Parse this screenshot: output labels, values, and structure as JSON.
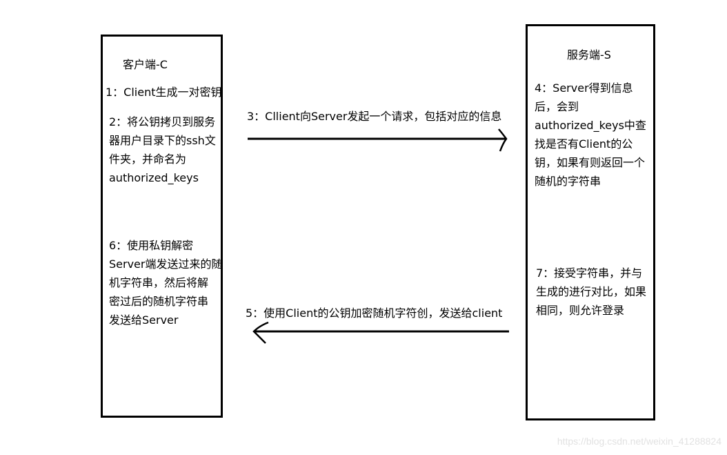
{
  "client": {
    "title": "客户端-C",
    "step1": "1：Client生成一对密钥",
    "step2": [
      "2：将公钥拷贝到服务",
      "器用户目录下的ssh文",
      "件夹，并命名为",
      "authorized_keys"
    ],
    "step6": [
      "6：使用私钥解密",
      "Server端发送过来的随",
      "机字符串，然后将解",
      "密过后的随机字符串",
      "发送给Server"
    ]
  },
  "server": {
    "title": "服务端-S",
    "step4": [
      "4：Server得到信息",
      "后，会到",
      "authorized_keys中查",
      "找是否有Client的公",
      "钥，如果有则返回一个",
      "随机的字符串"
    ],
    "step7": [
      "7：接受字符串，并与",
      "生成的进行对比，如果",
      "相同，则允许登录"
    ]
  },
  "arrows": {
    "step3": "3：Cllient向Server发起一个请求，包括对应的信息",
    "step5": "5：使用Client的公钥加密随机字符创，发送给client"
  },
  "watermark": "https://blog.csdn.net/weixin_41288824"
}
